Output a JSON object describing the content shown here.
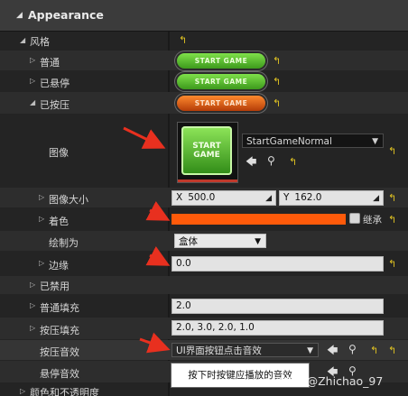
{
  "section": {
    "title": "Appearance"
  },
  "style": {
    "label": "风格"
  },
  "states": {
    "normal": {
      "label": "普通",
      "image_text": "START GAME"
    },
    "hovered": {
      "label": "已悬停",
      "image_text": "START GAME"
    },
    "pressed": {
      "label": "已按压",
      "image_text": "START GAME"
    }
  },
  "brush": {
    "image_label": "图像",
    "image_asset": "StartGameNormal",
    "thumb_text": "START GAME",
    "image_size_label": "图像大小",
    "size_x_key": "X",
    "size_x": "500.0",
    "size_y_key": "Y",
    "size_y": "162.0",
    "tint_label": "着色",
    "tint_color": "#ff5a0a",
    "inherit_label": "继承",
    "draw_as_label": "绘制为",
    "draw_as_value": "盒体",
    "margin_label": "边缘",
    "margin_value": "0.0"
  },
  "disabled": {
    "label": "已禁用"
  },
  "normal_padding": {
    "label": "普通填充",
    "value": "2.0"
  },
  "pressed_padding": {
    "label": "按压填充",
    "value": "2.0, 3.0, 2.0, 1.0"
  },
  "pressed_sound": {
    "label": "按压音效",
    "value": "UI界面按钮点击音效"
  },
  "hovered_sound": {
    "label": "悬停音效"
  },
  "tooltip": {
    "text": "按下时按键应播放的音效"
  },
  "partial_row": {
    "label": "颜色和不透明度"
  },
  "watermark": {
    "text": "CSDN @Zhichao_97"
  },
  "colors": {
    "reset_icon": "#e2c422",
    "annotation_arrow": "#e8301f"
  }
}
